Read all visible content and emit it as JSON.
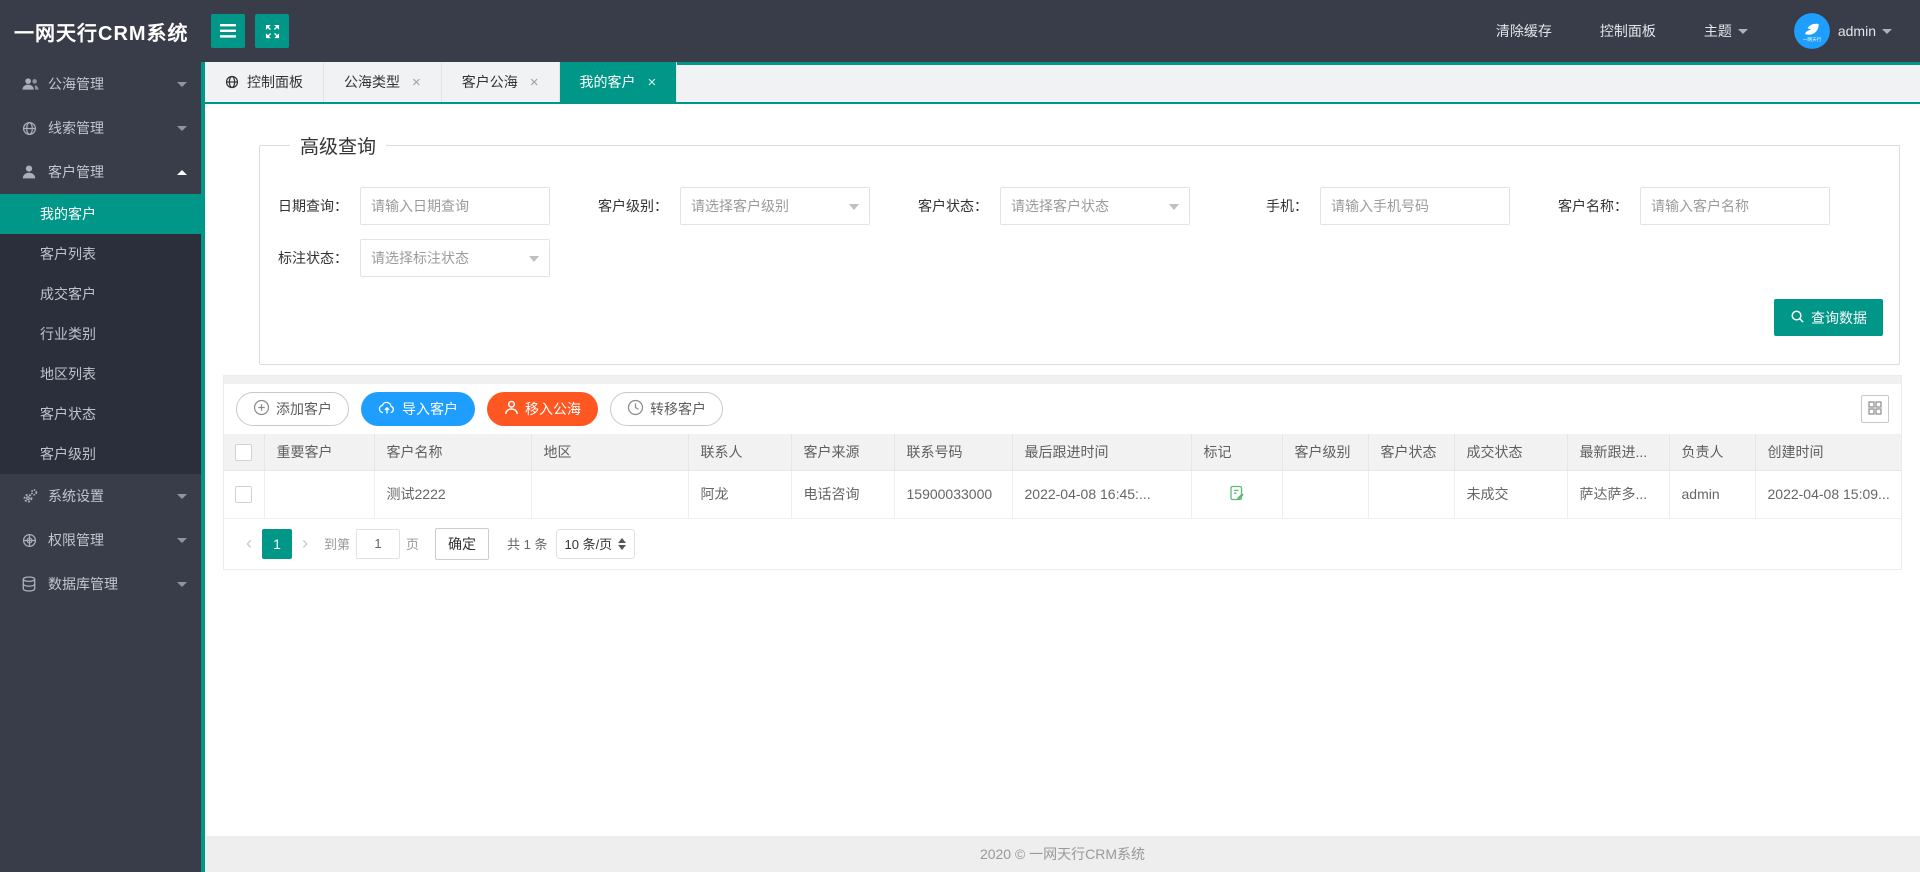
{
  "app": {
    "title": "一网天行CRM系统"
  },
  "header": {
    "clear_cache": "清除缓存",
    "control_panel": "控制面板",
    "theme": "主题",
    "username": "admin"
  },
  "sidebar": {
    "items": [
      {
        "label": "公海管理",
        "icon": "users-icon"
      },
      {
        "label": "线索管理",
        "icon": "globe-icon"
      },
      {
        "label": "客户管理",
        "icon": "user-icon",
        "expanded": true,
        "children": [
          {
            "label": "我的客户",
            "active": true
          },
          {
            "label": "客户列表"
          },
          {
            "label": "成交客户"
          },
          {
            "label": "行业类别"
          },
          {
            "label": "地区列表"
          },
          {
            "label": "客户状态"
          },
          {
            "label": "客户级别"
          }
        ]
      },
      {
        "label": "系统设置",
        "icon": "gear-icon"
      },
      {
        "label": "权限管理",
        "icon": "network-icon"
      },
      {
        "label": "数据库管理",
        "icon": "database-icon"
      }
    ]
  },
  "tabs": [
    {
      "label": "控制面板",
      "closable": false
    },
    {
      "label": "公海类型",
      "closable": true
    },
    {
      "label": "客户公海",
      "closable": true
    },
    {
      "label": "我的客户",
      "closable": true,
      "active": true
    }
  ],
  "query": {
    "title": "高级查询",
    "fields": [
      {
        "label": "日期查询：",
        "placeholder": "请输入日期查询",
        "type": "input"
      },
      {
        "label": "客户级别：",
        "placeholder": "请选择客户级别",
        "type": "select"
      },
      {
        "label": "客户状态：",
        "placeholder": "请选择客户状态",
        "type": "select"
      },
      {
        "label": "手机：",
        "placeholder": "请输入手机号码",
        "type": "input"
      },
      {
        "label": "客户名称：",
        "placeholder": "请输入客户名称",
        "type": "input"
      },
      {
        "label": "标注状态：",
        "placeholder": "请选择标注状态",
        "type": "select"
      }
    ],
    "submit": "查询数据"
  },
  "toolbar": {
    "add": "添加客户",
    "import": "导入客户",
    "move": "移入公海",
    "transfer": "转移客户"
  },
  "table": {
    "headers": [
      "重要客户",
      "客户名称",
      "地区",
      "联系人",
      "客户来源",
      "联系号码",
      "最后跟进时间",
      "标记",
      "客户级别",
      "客户状态",
      "成交状态",
      "最新跟进...",
      "负责人",
      "创建时间"
    ],
    "row": {
      "important": "",
      "name": "测试2222",
      "region": "",
      "contact": "阿龙",
      "source": "电话咨询",
      "phone": "15900033000",
      "last_follow_time": "2022-04-08 16:45:...",
      "mark": "mark-edit-icon",
      "level": "",
      "status": "",
      "deal_status": "未成交",
      "latest_follow": "萨达萨多...",
      "owner": "admin",
      "create_time": "2022-04-08 15:09..."
    }
  },
  "pagination": {
    "page": "1",
    "goto_label": "到第",
    "goto_value": "1",
    "page_unit": "页",
    "confirm": "确定",
    "total": "共 1 条",
    "page_size": "10 条/页"
  },
  "footer": {
    "text": "2020 ©  一网天行CRM系统"
  },
  "colors": {
    "accent": "#009688",
    "header_bg": "#393d49",
    "primary_blue": "#1e9fff",
    "danger_red": "#ff5722",
    "mark_green": "#5fb878"
  }
}
